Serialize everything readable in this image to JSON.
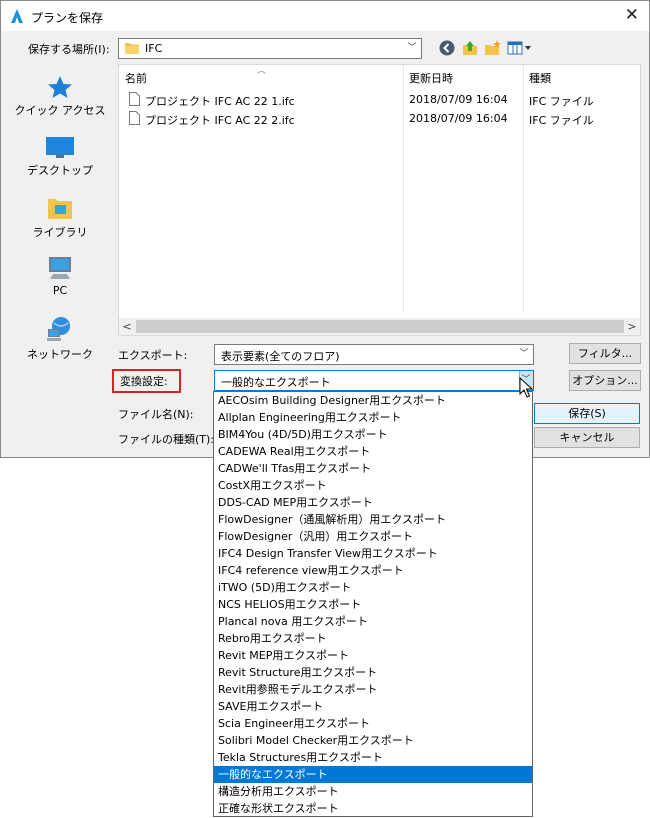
{
  "window": {
    "title": "プランを保存",
    "close": "✕"
  },
  "location": {
    "label": "保存する場所(I):",
    "value": "IFC"
  },
  "places": [
    {
      "label": "クイック アクセス",
      "icon": "star-icon"
    },
    {
      "label": "デスクトップ",
      "icon": "desktop-icon"
    },
    {
      "label": "ライブラリ",
      "icon": "library-icon"
    },
    {
      "label": "PC",
      "icon": "pc-icon"
    },
    {
      "label": "ネットワーク",
      "icon": "network-icon"
    }
  ],
  "filelist": {
    "columns": {
      "name": "名前",
      "date": "更新日時",
      "type": "種類"
    },
    "rows": [
      {
        "name": "プロジェクト IFC AC 22 1.ifc",
        "date": "2018/07/09 16:04",
        "type": "IFC ファイル"
      },
      {
        "name": "プロジェクト IFC AC 22 2.ifc",
        "date": "2018/07/09 16:04",
        "type": "IFC ファイル"
      }
    ]
  },
  "export": {
    "label": "エクスポート:",
    "value": "表示要素(全てのフロア)",
    "button": "フィルタ..."
  },
  "conversion": {
    "label": "変換設定:",
    "value": "一般的なエクスポート",
    "button": "オプション..."
  },
  "filename": {
    "label": "ファイル名(N):",
    "save_button": "保存(S)"
  },
  "filetype": {
    "label": "ファイルの種類(T):",
    "cancel_button": "キャンセル"
  },
  "dropdown": {
    "items": [
      "AECOsim Building Designer用エクスポート",
      "Allplan Engineering用エクスポート",
      "BIM4You (4D/5D)用エクスポート",
      "CADEWA Real用エクスポート",
      "CADWe'll Tfas用エクスポート",
      "CostX用エクスポート",
      "DDS-CAD MEP用エクスポート",
      "FlowDesigner（通風解析用）用エクスポート",
      "FlowDesigner（汎用）用エクスポート",
      "IFC4 Design Transfer View用エクスポート",
      "IFC4 reference view用エクスポート",
      "iTWO (5D)用エクスポート",
      "NCS HELIOS用エクスポート",
      "Plancal nova 用エクスポート",
      "Rebro用エクスポート",
      "Revit MEP用エクスポート",
      "Revit Structure用エクスポート",
      "Revit用参照モデルエクスポート",
      "SAVE用エクスポート",
      "Scia Engineer用エクスポート",
      "Solibri Model Checker用エクスポート",
      "Tekla Structures用エクスポート",
      "一般的なエクスポート",
      "構造分析用エクスポート",
      "正確な形状エクスポート"
    ],
    "selected_index": 22
  },
  "colors": {
    "selection": "#0078d7",
    "highlight_box": "#e0201e"
  }
}
